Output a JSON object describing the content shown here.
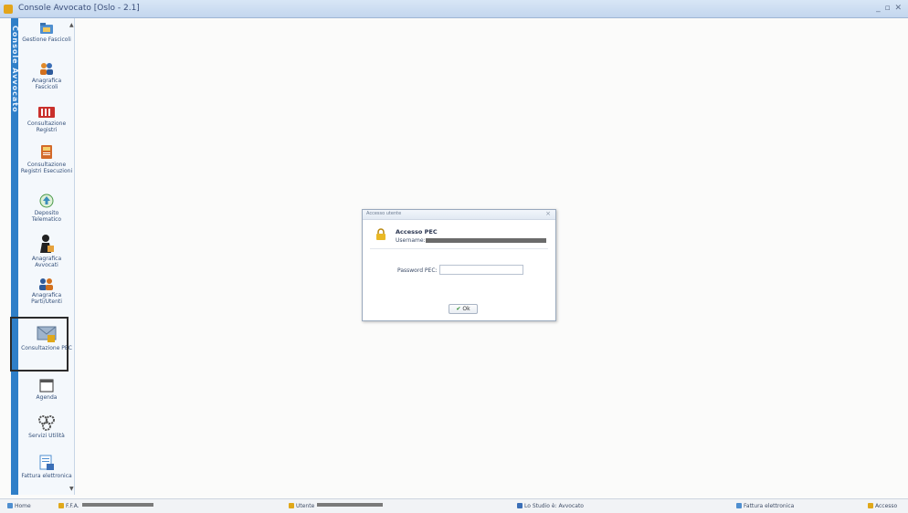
{
  "window": {
    "title": "Console Avvocato [Oslo - 2.1]",
    "controls": "_ ▫ ✕"
  },
  "sidebar": {
    "band_label": "Console Avvocato",
    "items": [
      {
        "label": "Gestione Fascicoli",
        "icon": "folder-icon"
      },
      {
        "label": "Anagrafica Fascicoli",
        "icon": "people-icon"
      },
      {
        "label": "Consultazione Registri",
        "icon": "registry-icon"
      },
      {
        "label": "Consultazione Registri Esecuzioni",
        "icon": "book-icon"
      },
      {
        "label": "Deposito Telematico",
        "icon": "upload-icon"
      },
      {
        "label": "Anagrafica Avvocati",
        "icon": "lawyer-icon"
      },
      {
        "label": "Anagrafica Parti/Utenti",
        "icon": "users-icon"
      },
      {
        "label": "Consultazione PEC",
        "icon": "pec-mail-icon",
        "selected": true
      },
      {
        "label": "Agenda",
        "icon": "calendar-icon"
      },
      {
        "label": "Servizi Utilità",
        "icon": "gears-icon"
      },
      {
        "label": "Fattura elettronica",
        "icon": "invoice-icon"
      }
    ]
  },
  "dialog": {
    "title": "Accesso utente",
    "heading": "Accesso PEC",
    "sub_label": "Username:",
    "password_label": "Password PEC:",
    "password_value": "",
    "ok_label": "Ok"
  },
  "statusbar": {
    "items": [
      {
        "label": "Home"
      },
      {
        "label": "F.F.A."
      },
      {
        "label": "Utente"
      },
      {
        "label": "Lo Studio è: Avvocato"
      },
      {
        "label": "Fattura elettronica"
      },
      {
        "label": "Accesso"
      }
    ]
  },
  "colors": {
    "sidebar_band": "#2f7fc8",
    "titlebar": "#c3d6ee",
    "selection_frame": "#2b2b2b"
  }
}
